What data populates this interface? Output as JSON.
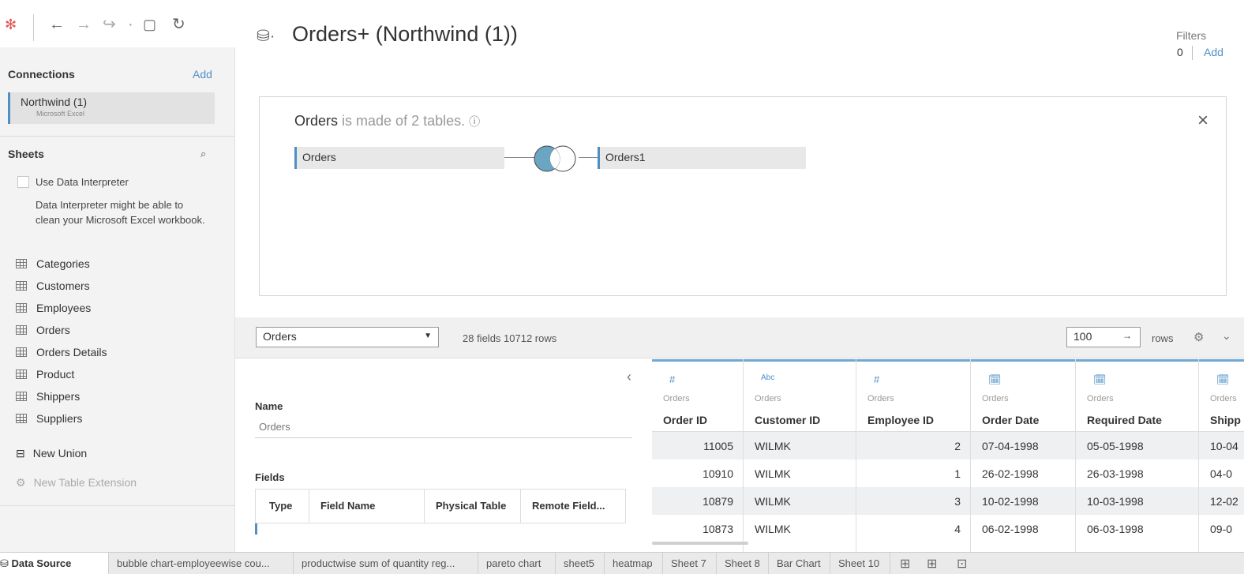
{
  "toolbar": {
    "logo_icon": "tableau-logo-icon",
    "back": "←",
    "forward": "→",
    "redo": "↪",
    "dropdown": "·",
    "save": "▢",
    "refresh": "↻"
  },
  "left": {
    "connections_label": "Connections",
    "connections_add": "Add",
    "connection": {
      "name": "Northwind (1)",
      "type": "Microsoft Excel"
    },
    "sheets_label": "Sheets",
    "search_icon": "search-icon",
    "use_interpreter": "Use Data Interpreter",
    "interpreter_note": "Data Interpreter might be able to clean your Microsoft Excel workbook.",
    "sheets": [
      "Categories",
      "Customers",
      "Employees",
      "Orders",
      "Orders Details",
      "Product",
      "Shippers",
      "Suppliers"
    ],
    "new_union": "New Union",
    "new_extension": "New Table Extension"
  },
  "header": {
    "title": "Orders+ (Northwind (1))",
    "filters_label": "Filters",
    "filters_count": "0",
    "filters_add": "Add"
  },
  "canvas": {
    "made_of_bold": "Orders",
    "made_of_rest": "is made of 2 tables.",
    "left_table": "Orders",
    "right_table": "Orders1",
    "close": "×"
  },
  "gridbar": {
    "table_select": "Orders",
    "fields_info": "28 fields 10712 rows",
    "rows_value": "100",
    "rows_label": "rows"
  },
  "meta": {
    "collapse": "‹",
    "name_label": "Name",
    "name_value": "Orders",
    "fields_label": "Fields",
    "headers": [
      "Type",
      "Field Name",
      "Physical Table",
      "Remote Field..."
    ]
  },
  "grid": {
    "columns": [
      {
        "type_icon": "#",
        "source": "Orders",
        "name": "Order ID"
      },
      {
        "type_icon": "Abc",
        "source": "Orders",
        "name": "Customer ID"
      },
      {
        "type_icon": "#",
        "source": "Orders",
        "name": "Employee ID"
      },
      {
        "type_icon": "🗓",
        "source": "Orders",
        "name": "Order Date"
      },
      {
        "type_icon": "🗓",
        "source": "Orders",
        "name": "Required Date"
      },
      {
        "type_icon": "🗓",
        "source": "Orders",
        "name": "Shipp"
      }
    ],
    "rows": [
      [
        "11005",
        "WILMK",
        "2",
        "07-04-1998",
        "05-05-1998",
        "10-04"
      ],
      [
        "10910",
        "WILMK",
        "1",
        "26-02-1998",
        "26-03-1998",
        "04-0"
      ],
      [
        "10879",
        "WILMK",
        "3",
        "10-02-1998",
        "10-03-1998",
        "12-02"
      ],
      [
        "10873",
        "WILMK",
        "4",
        "06-02-1998",
        "06-03-1998",
        "09-0"
      ]
    ]
  },
  "tabs": [
    "Data Source",
    "bubble chart-employeewise cou...",
    "productwise sum of quantity reg...",
    "pareto chart",
    "sheet5",
    "heatmap",
    "Sheet 7",
    "Sheet 8",
    "Bar Chart",
    "Sheet 10"
  ]
}
